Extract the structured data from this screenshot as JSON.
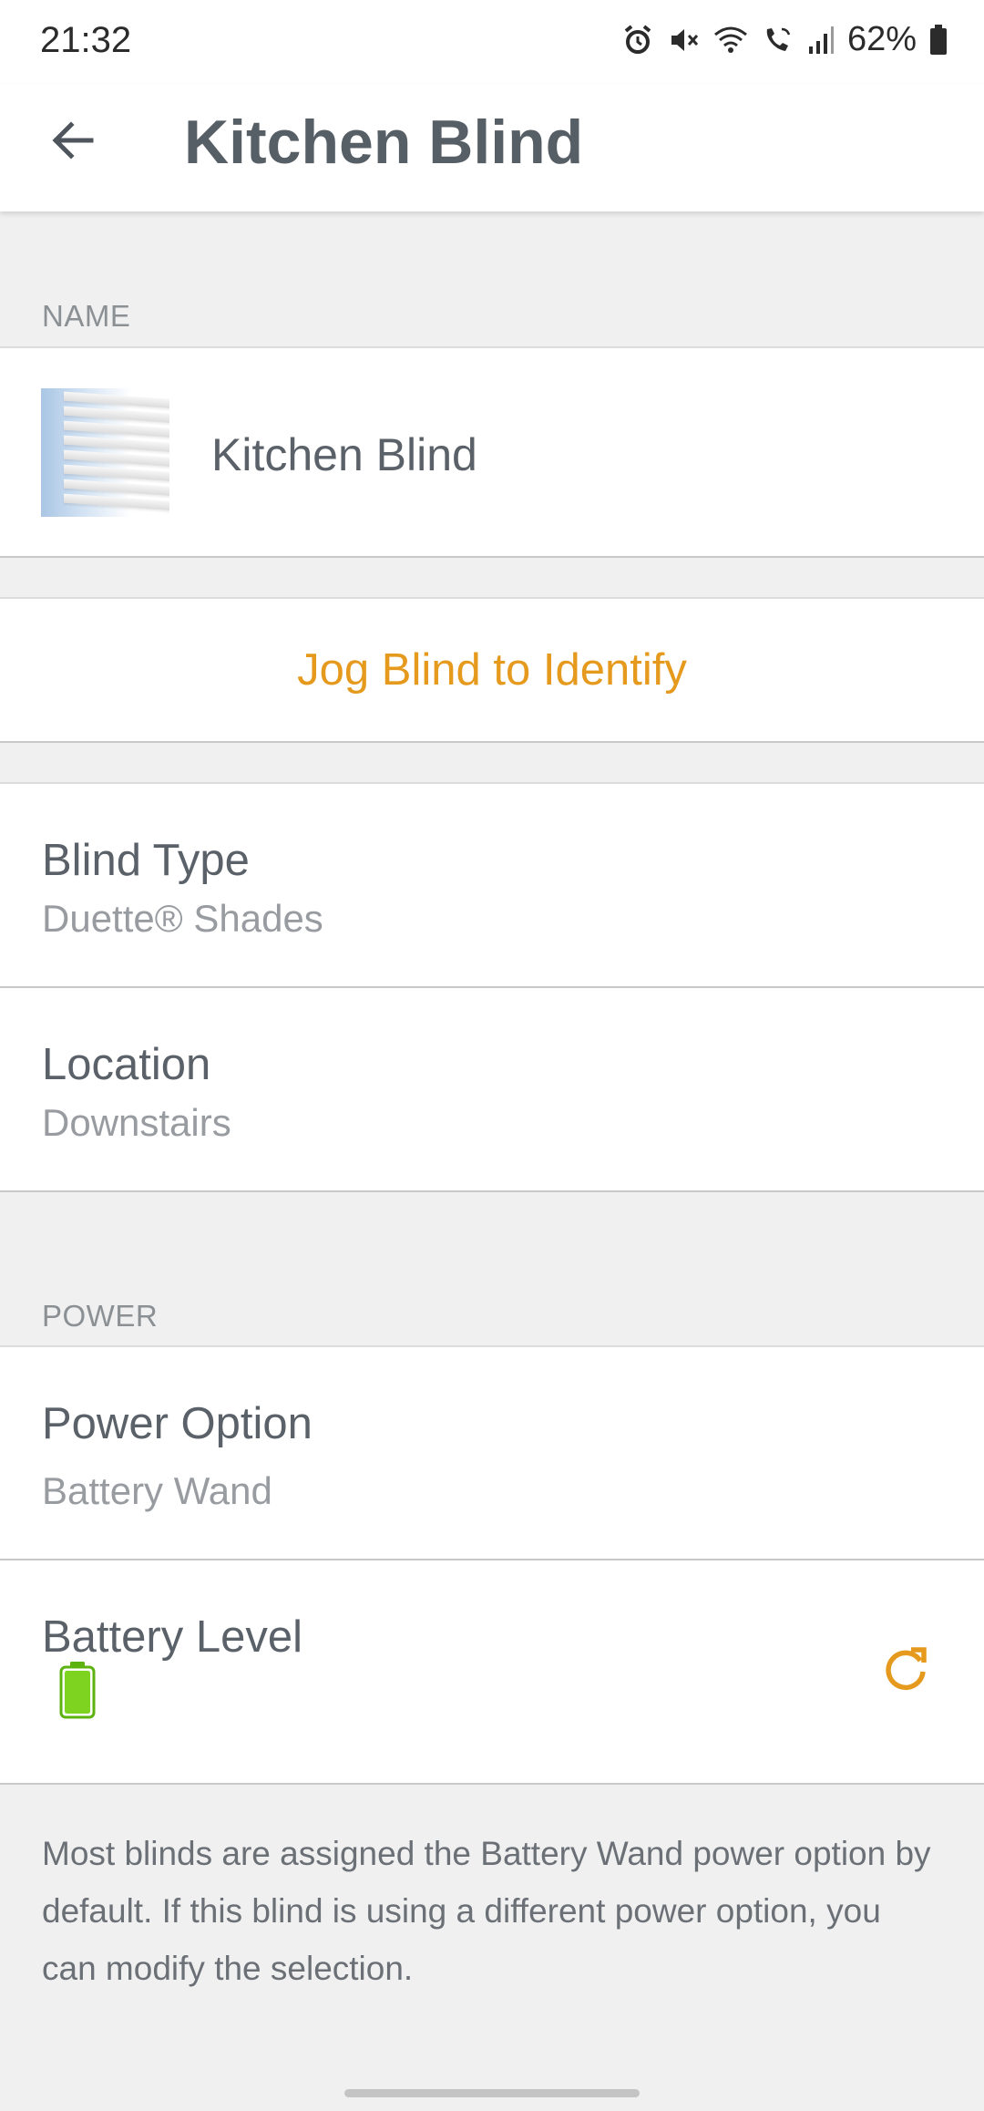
{
  "status_bar": {
    "time": "21:32",
    "battery_percent": "62%",
    "icons": [
      "alarm-icon",
      "mute-icon",
      "wifi-icon",
      "wifi-calling-icon",
      "signal-icon",
      "battery-icon"
    ]
  },
  "app_bar": {
    "back_icon": "arrow-left-icon",
    "title": "Kitchen Blind"
  },
  "name_section": {
    "label": "NAME",
    "name": "Kitchen Blind"
  },
  "jog_button": {
    "label": "Jog Blind to Identify"
  },
  "details": {
    "blind_type": {
      "title": "Blind Type",
      "value": "Duette® Shades"
    },
    "location": {
      "title": "Location",
      "value": "Downstairs"
    }
  },
  "power_section": {
    "label": "POWER",
    "power_option": {
      "title": "Power Option",
      "value": "Battery Wand"
    },
    "battery_level": {
      "title": "Battery Level",
      "level": 1.0,
      "refresh_icon": "refresh-icon"
    }
  },
  "footnote": "Most blinds are assigned the Battery Wand power option by default. If this blind is using a different power option, you can modify the selection.",
  "colors": {
    "accent": "#e59a1e",
    "battery_green": "#7ed321",
    "text_primary": "#5a6169",
    "text_secondary": "#989ca1"
  }
}
